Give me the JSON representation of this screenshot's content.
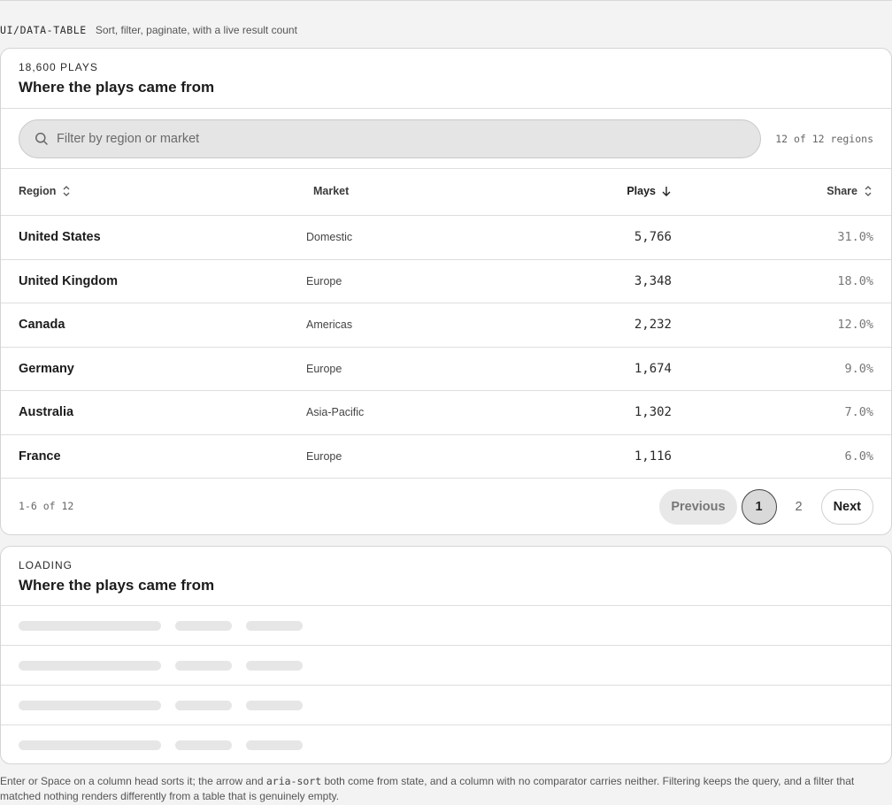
{
  "caption": {
    "code": "UI/DATA-TABLE",
    "description": "Sort, filter, paginate, with a live result count"
  },
  "main_card": {
    "eyebrow": "18,600 PLAYS",
    "title": "Where the plays came from",
    "search": {
      "placeholder": "Filter by region or market",
      "value": ""
    },
    "result_count": "12 of 12 regions",
    "columns": {
      "region": "Region",
      "market": "Market",
      "plays": "Plays",
      "share": "Share"
    },
    "sort": {
      "column": "plays",
      "direction": "descending"
    },
    "rows": [
      {
        "region": "United States",
        "market": "Domestic",
        "plays": "5,766",
        "share": "31.0%"
      },
      {
        "region": "United Kingdom",
        "market": "Europe",
        "plays": "3,348",
        "share": "18.0%"
      },
      {
        "region": "Canada",
        "market": "Americas",
        "plays": "2,232",
        "share": "12.0%"
      },
      {
        "region": "Germany",
        "market": "Europe",
        "plays": "1,674",
        "share": "9.0%"
      },
      {
        "region": "Australia",
        "market": "Asia-Pacific",
        "plays": "1,302",
        "share": "7.0%"
      },
      {
        "region": "France",
        "market": "Europe",
        "plays": "1,116",
        "share": "6.0%"
      }
    ],
    "pagination": {
      "range": "1-6 of 12",
      "previous": "Previous",
      "pages": [
        "1",
        "2"
      ],
      "current_page": "1",
      "next": "Next"
    }
  },
  "loading_card": {
    "eyebrow": "LOADING",
    "title": "Where the plays came from",
    "skeleton_rows": 4
  },
  "footnote": {
    "part1": "Enter or Space on a column head sorts it; the arrow and ",
    "code": "aria-sort",
    "part2": " both come from state, and a column with no comparator carries neither. Filtering keeps the query, and a filter that matched nothing renders differently from a table that is genuinely empty."
  },
  "colors": {
    "page_bg": "#f3f3f3",
    "card_bg": "#ffffff",
    "border": "#d4d4d4",
    "search_bg": "#e5e5e5",
    "skeleton": "#e6e6e6"
  },
  "icons": {
    "search": "search-icon",
    "sortable": "sort-unsorted-icon",
    "sorted_desc": "sort-arrow-down-icon"
  }
}
